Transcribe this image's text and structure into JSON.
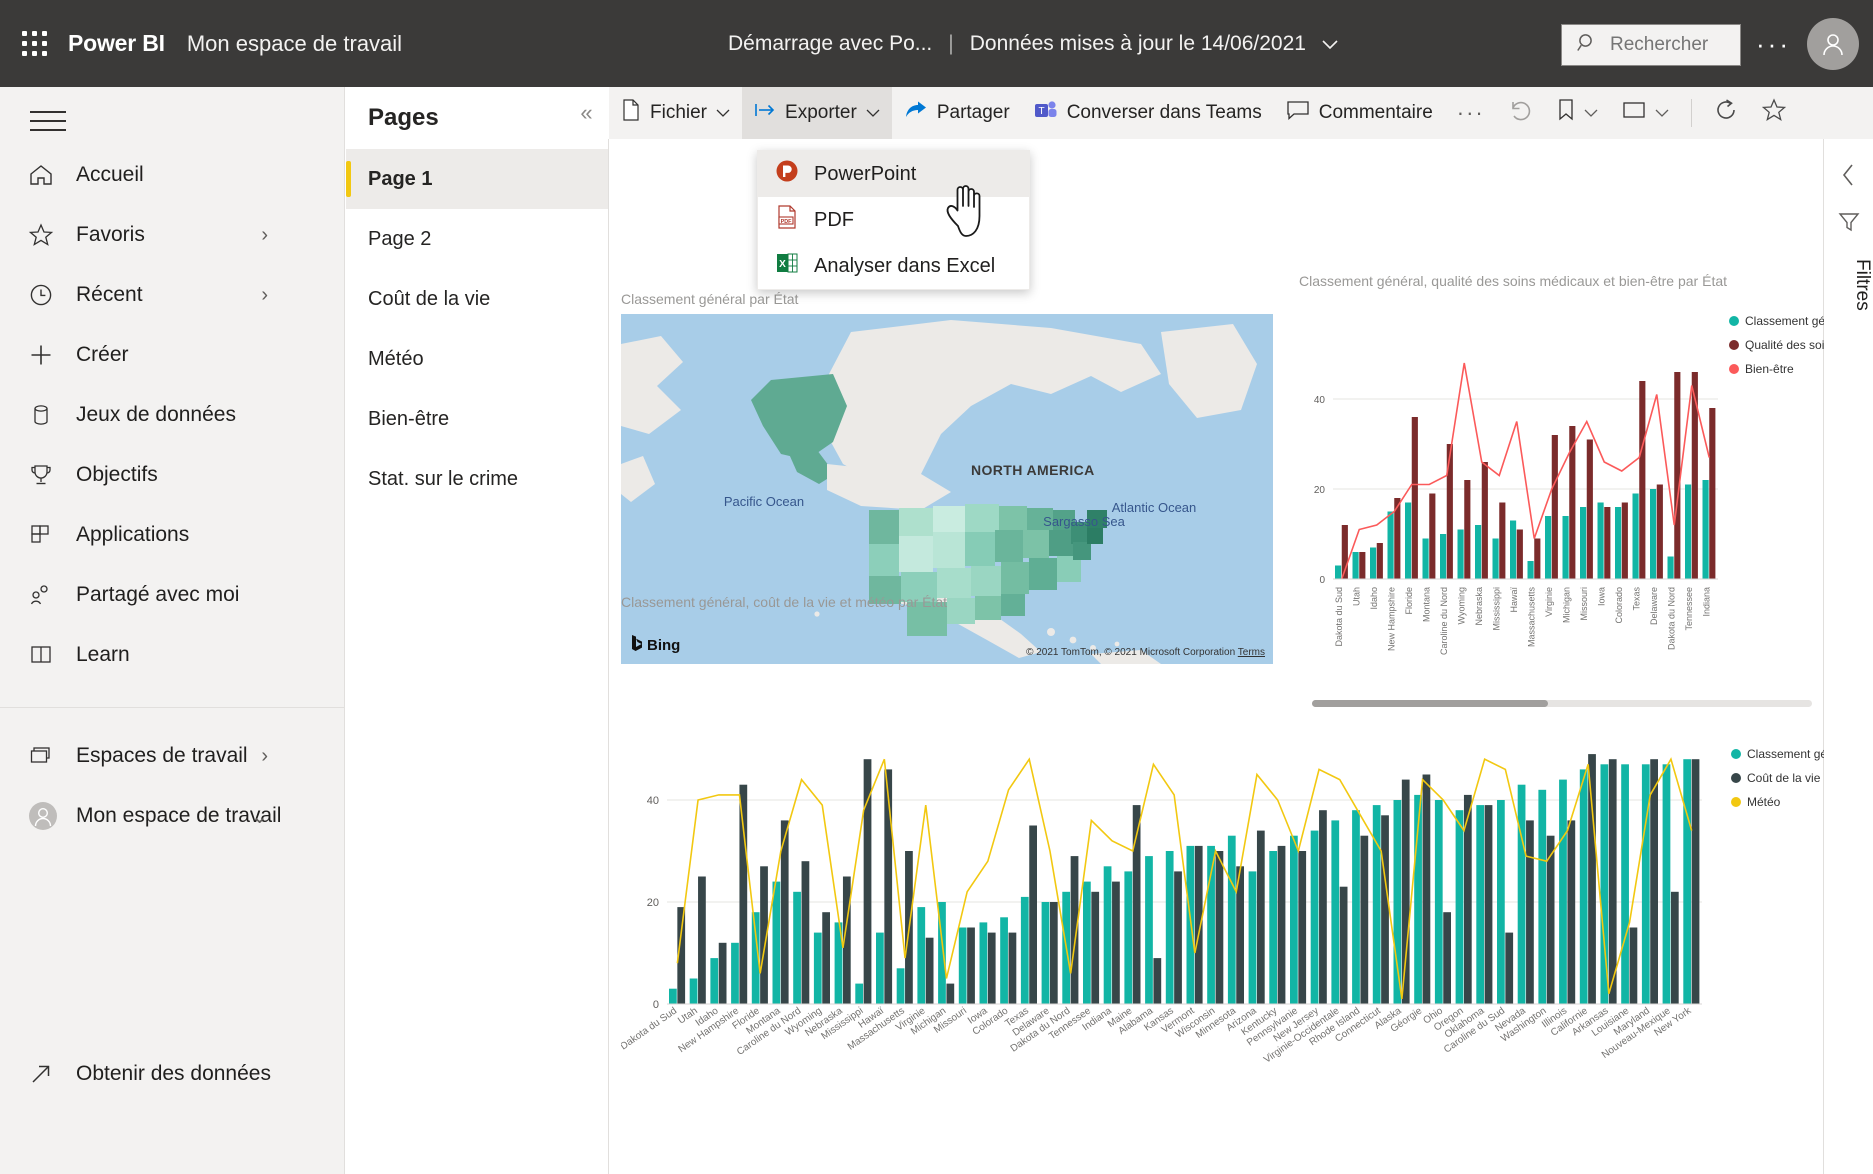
{
  "topbar": {
    "waffle_icon": "app-launcher-icon",
    "brand": "Power BI",
    "workspace": "Mon espace de travail",
    "report_name": "Démarrage avec Po...",
    "separator": "|",
    "refreshed": "Données mises à jour le 14/06/2021",
    "search_placeholder": "Rechercher",
    "ellipsis": "···",
    "avatar_icon": "user-avatar-icon"
  },
  "sidebar": {
    "hamburger_icon": "hamburger-menu-icon",
    "items": [
      {
        "label": "Accueil",
        "icon": "home-icon",
        "expand": ""
      },
      {
        "label": "Favoris",
        "icon": "star-icon",
        "expand": "›"
      },
      {
        "label": "Récent",
        "icon": "clock-icon",
        "expand": "›"
      },
      {
        "label": "Créer",
        "icon": "plus-icon",
        "expand": ""
      },
      {
        "label": "Jeux de données",
        "icon": "database-icon",
        "expand": ""
      },
      {
        "label": "Objectifs",
        "icon": "trophy-icon",
        "expand": ""
      },
      {
        "label": "Applications",
        "icon": "apps-grid-icon",
        "expand": ""
      },
      {
        "label": "Partagé avec moi",
        "icon": "people-share-icon",
        "expand": ""
      },
      {
        "label": "Learn",
        "icon": "book-icon",
        "expand": ""
      }
    ],
    "bottom_items": [
      {
        "label": "Espaces de travail",
        "icon": "workspaces-icon",
        "expand": "›"
      },
      {
        "label": "Mon espace de travail",
        "icon": "user-avatar-icon",
        "expand": "⌄"
      }
    ],
    "get_data": {
      "label": "Obtenir des données",
      "icon": "arrow-up-right-icon"
    }
  },
  "pages_pane": {
    "title": "Pages",
    "collapse_icon": "«",
    "items": [
      {
        "label": "Page 1",
        "selected": true
      },
      {
        "label": "Page 2",
        "selected": false
      },
      {
        "label": "Coût de la vie",
        "selected": false
      },
      {
        "label": "Météo",
        "selected": false
      },
      {
        "label": "Bien-être",
        "selected": false
      },
      {
        "label": "Stat. sur le crime",
        "selected": false
      }
    ]
  },
  "toolbar": {
    "file": "Fichier",
    "export": "Exporter",
    "share": "Partager",
    "teams": "Converser dans Teams",
    "comment": "Commentaire",
    "more": "···",
    "reset_icon": "undo-reset-icon",
    "bookmark_icon": "bookmark-icon",
    "view_icon": "view-fit-icon",
    "refresh_icon": "refresh-icon",
    "favorite_icon": "star-outline-icon",
    "chevron": "⌄"
  },
  "export_menu": {
    "items": [
      {
        "label": "PowerPoint",
        "icon": "powerpoint-icon",
        "highlighted": true
      },
      {
        "label": "PDF",
        "icon": "pdf-icon",
        "highlighted": false
      },
      {
        "label": "Analyser dans Excel",
        "icon": "excel-icon",
        "highlighted": false
      }
    ]
  },
  "filters_rail": {
    "collapse_icon": "‹",
    "filter_icon": "filter-icon",
    "label": "Filtres"
  },
  "map_vis": {
    "title": "Classement général par État",
    "continent_label": "NORTH AMERICA",
    "ocean_labels": [
      "Pacific Ocean",
      "Atlantic Ocean",
      "Sargasso Sea"
    ],
    "provider": "Bing",
    "credit": "© 2021 TomTom, © 2021 Microsoft Corporation",
    "terms": "Terms"
  },
  "chart_data": [
    {
      "id": "health-wellbeing",
      "type": "bar",
      "title": "Classement général, qualité des soins médicaux et bien-être par État",
      "xlabel": "",
      "ylabel": "",
      "ylim": [
        0,
        50
      ],
      "yticks": [
        0,
        20,
        40
      ],
      "grid": true,
      "legend_position": "right",
      "categories": [
        "Dakota du Sud",
        "Utah",
        "Idaho",
        "New Hampshire",
        "Floride",
        "Montana",
        "Caroline du Nord",
        "Wyoming",
        "Nebraska",
        "Mississippi",
        "Hawaï",
        "Massachusetts",
        "Virginie",
        "Michigan",
        "Missouri",
        "Iowa",
        "Colorado",
        "Texas",
        "Delaware",
        "Dakota du Nord",
        "Tennessee",
        "Indiana"
      ],
      "series": [
        {
          "name": "Classement général",
          "color": "#12b5a5",
          "kind": "bar",
          "values": [
            3,
            6,
            7,
            15,
            17,
            9,
            10,
            11,
            12,
            9,
            13,
            4,
            14,
            14,
            16,
            17,
            16,
            19,
            20,
            5,
            21,
            22
          ]
        },
        {
          "name": "Qualité des soins mé...",
          "color": "#7b2b2b",
          "kind": "bar",
          "values": [
            12,
            6,
            8,
            18,
            36,
            19,
            30,
            22,
            26,
            17,
            11,
            9,
            32,
            34,
            31,
            16,
            17,
            44,
            21,
            46,
            46,
            38
          ]
        },
        {
          "name": "Bien-être",
          "color": "#fb5a5a",
          "kind": "line",
          "values": [
            0,
            11,
            12,
            15,
            21,
            21,
            23,
            48,
            26,
            23,
            35,
            9,
            20,
            28,
            35,
            26,
            24,
            27,
            41,
            12,
            43,
            27
          ]
        }
      ]
    },
    {
      "id": "overall-cost-weather",
      "type": "bar",
      "title": "Classement général, coût de la vie et météo par État",
      "xlabel": "",
      "ylabel": "",
      "ylim": [
        0,
        50
      ],
      "yticks": [
        0,
        20,
        40
      ],
      "grid": true,
      "legend_position": "right",
      "categories": [
        "Dakota du Sud",
        "Utah",
        "Idaho",
        "New Hampshire",
        "Floride",
        "Montana",
        "Caroline du Nord",
        "Wyoming",
        "Nebraska",
        "Mississippi",
        "Hawaï",
        "Massachusetts",
        "Virginie",
        "Michigan",
        "Missouri",
        "Iowa",
        "Colorado",
        "Texas",
        "Delaware",
        "Dakota du Nord",
        "Tennessee",
        "Indiana",
        "Maine",
        "Alabama",
        "Kansas",
        "Vermont",
        "Wisconsin",
        "Minnesota",
        "Arizona",
        "Kentucky",
        "Pennsylvanie",
        "New Jersey",
        "Virginie-Occidentale",
        "Rhode Island",
        "Connecticut",
        "Alaska",
        "Géorgie",
        "Ohio",
        "Oregon",
        "Oklahoma",
        "Caroline du Sud",
        "Nevada",
        "Washington",
        "Illinois",
        "Californie",
        "Arkansas",
        "Louisiane",
        "Maryland",
        "Nouveau-Mexique",
        "New York"
      ],
      "series": [
        {
          "name": "Classement général",
          "color": "#12b5a5",
          "kind": "bar",
          "values": [
            3,
            5,
            9,
            12,
            18,
            24,
            22,
            14,
            16,
            4,
            14,
            7,
            19,
            20,
            15,
            16,
            17,
            21,
            20,
            22,
            24,
            27,
            26,
            29,
            30,
            31,
            31,
            33,
            26,
            30,
            33,
            34,
            36,
            38,
            39,
            40,
            41,
            40,
            38,
            39,
            40,
            43,
            42,
            44,
            46,
            47,
            47,
            47,
            47,
            48
          ]
        },
        {
          "name": "Coût de la vie",
          "color": "#374649",
          "kind": "bar",
          "values": [
            19,
            25,
            12,
            43,
            27,
            36,
            28,
            18,
            25,
            48,
            46,
            30,
            13,
            4,
            15,
            14,
            14,
            35,
            20,
            29,
            22,
            24,
            39,
            9,
            26,
            31,
            30,
            27,
            34,
            31,
            30,
            38,
            23,
            33,
            37,
            44,
            45,
            18,
            41,
            39,
            14,
            36,
            33,
            36,
            49,
            48,
            15,
            48,
            22,
            48
          ]
        },
        {
          "name": "Météo",
          "color": "#f2c811",
          "kind": "line",
          "values": [
            8,
            40,
            41,
            41,
            6,
            30,
            44,
            39,
            11,
            38,
            48,
            9,
            39,
            5,
            22,
            28,
            42,
            48,
            30,
            6,
            36,
            32,
            30,
            47,
            41,
            10,
            30,
            22,
            45,
            40,
            30,
            46,
            44,
            37,
            30,
            1,
            44,
            40,
            34,
            48,
            46,
            29,
            28,
            34,
            47,
            2,
            16,
            41,
            48,
            34
          ]
        }
      ]
    }
  ]
}
